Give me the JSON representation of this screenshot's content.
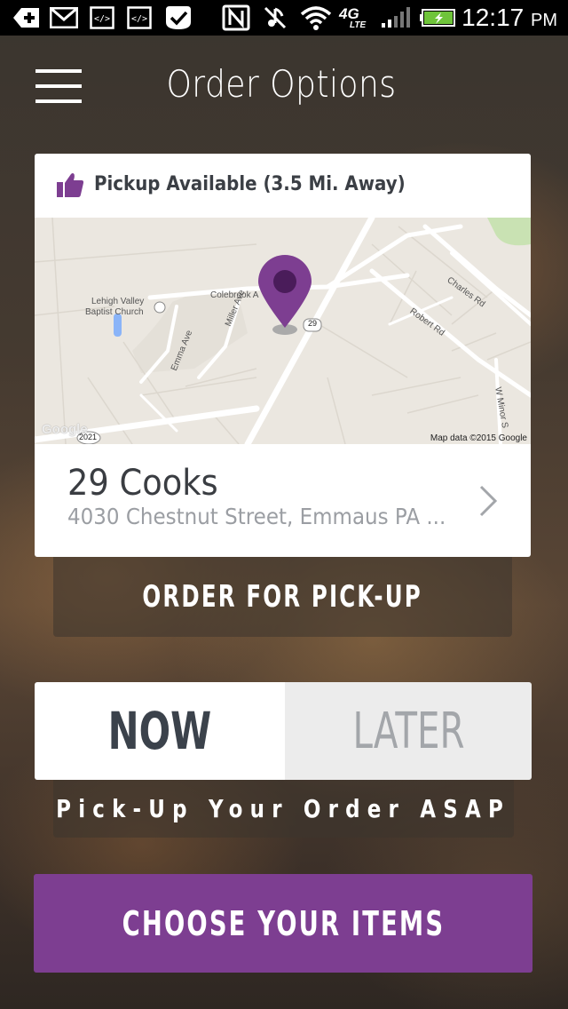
{
  "status_bar": {
    "time": "12:17",
    "ampm": "PM",
    "network": "4G",
    "network_sub": "LTE",
    "icons": [
      "add-icon",
      "gmail-icon",
      "code-icon",
      "code-icon",
      "check-badge-icon",
      "nfc-icon",
      "mute-icon",
      "wifi-icon",
      "signal-icon",
      "battery-charging-icon"
    ]
  },
  "header": {
    "title": "Order Options",
    "menu_icon": "hamburger-menu-icon"
  },
  "restaurant_card": {
    "pickup_label": "Pickup Available (3.5 Mi. Away)",
    "pickup_icon": "thumbs-up-icon",
    "name": "29 Cooks",
    "address": "4030 Chestnut Street, Emmaus PA ...",
    "map": {
      "labels": {
        "church_line1": "Lehigh Valley",
        "church_line2": "Baptist Church",
        "colebrook": "Colebrook A",
        "miller": "Miller Ave",
        "emma": "Emma Ave",
        "charles": "Charles Rd",
        "robert": "Robert Rd",
        "minor": "W Minor S",
        "route29": "29",
        "route2021": "2021"
      },
      "google_logo": "Google",
      "copyright": "Map data ©2015 Google",
      "marker_color": "#7d3e91"
    }
  },
  "order_type": {
    "label": "ORDER FOR PICK-UP"
  },
  "timing": {
    "now_label": "NOW",
    "later_label": "LATER",
    "selected": "NOW",
    "description": "Pick-Up Your Order ASAP"
  },
  "cta": {
    "label": "CHOOSE YOUR ITEMS"
  },
  "colors": {
    "accent": "#7d3e91",
    "text_dark": "#3b424b",
    "text_muted": "#9b9ea3"
  }
}
